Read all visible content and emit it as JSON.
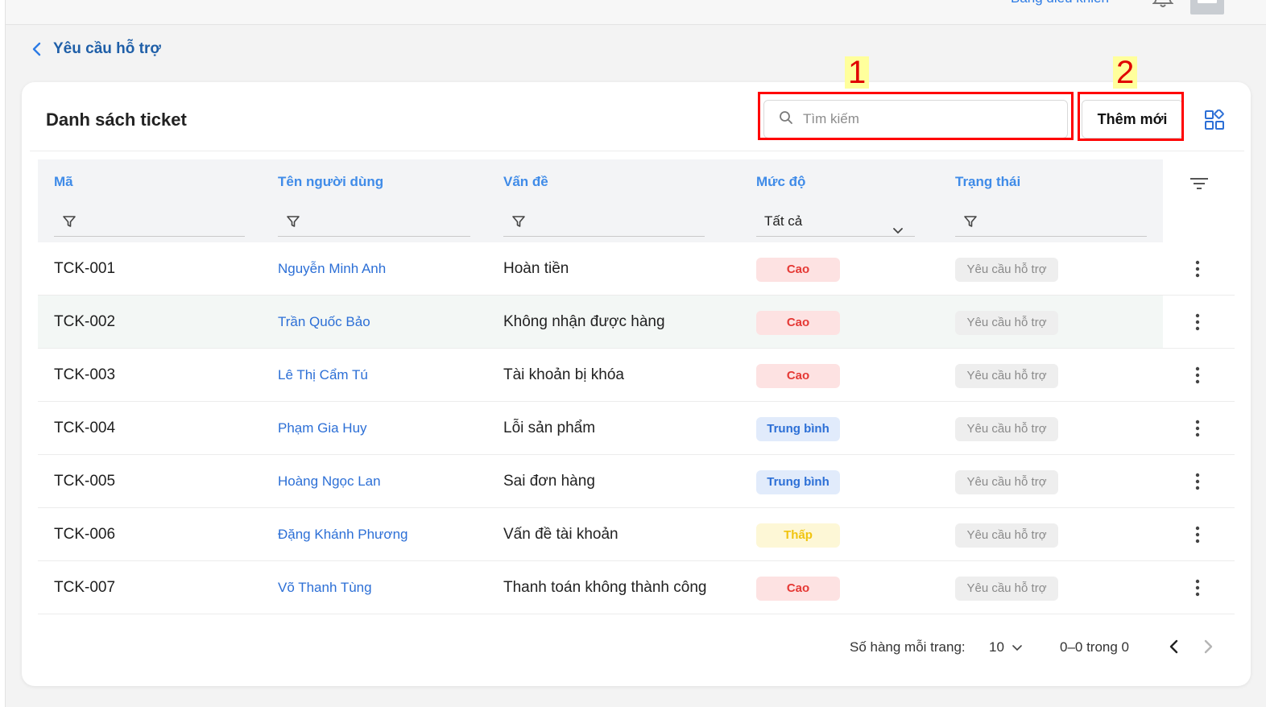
{
  "topbar": {
    "dashboard_link": "Bảng điều khiển"
  },
  "breadcrumb": {
    "label": "Yêu cầu hỗ trợ"
  },
  "card": {
    "title": "Danh sách ticket",
    "search_placeholder": "Tìm kiếm",
    "add_button": "Thêm mới",
    "annotations": [
      "1",
      "2"
    ]
  },
  "table": {
    "columns": {
      "code": "Mã",
      "user": "Tên người dùng",
      "issue": "Vấn đề",
      "level": "Mức độ",
      "status": "Trạng thái"
    },
    "level_filter_value": "Tất cả",
    "rows": [
      {
        "code": "TCK-001",
        "user": "Nguyễn Minh Anh",
        "issue": "Hoàn tiền",
        "level": "Cao",
        "status": "Yêu cầu hỗ trợ"
      },
      {
        "code": "TCK-002",
        "user": "Trần Quốc Bảo",
        "issue": "Không nhận được hàng",
        "level": "Cao",
        "status": "Yêu cầu hỗ trợ"
      },
      {
        "code": "TCK-003",
        "user": "Lê Thị Cẩm Tú",
        "issue": "Tài khoản bị khóa",
        "level": "Cao",
        "status": "Yêu cầu hỗ trợ"
      },
      {
        "code": "TCK-004",
        "user": "Phạm Gia Huy",
        "issue": "Lỗi sản phẩm",
        "level": "Trung bình",
        "status": "Yêu cầu hỗ trợ"
      },
      {
        "code": "TCK-005",
        "user": "Hoàng Ngọc Lan",
        "issue": "Sai đơn hàng",
        "level": "Trung bình",
        "status": "Yêu cầu hỗ trợ"
      },
      {
        "code": "TCK-006",
        "user": "Đặng Khánh Phương",
        "issue": "Vấn đề tài khoản",
        "level": "Thấp",
        "status": "Yêu cầu hỗ trợ"
      },
      {
        "code": "TCK-007",
        "user": "Võ Thanh Tùng",
        "issue": "Thanh toán không thành công",
        "level": "Cao",
        "status": "Yêu cầu hỗ trợ"
      }
    ]
  },
  "pagination": {
    "rows_per_page_label": "Số hàng mỗi trang:",
    "rows_per_page_value": "10",
    "range_text": "0–0 trong 0"
  },
  "colors": {
    "accent": "#3f8be8",
    "link": "#2c6fd6",
    "highlight": "#ff0000",
    "level_high": "#e53935",
    "level_mid": "#2c6fd6",
    "level_low": "#f1c40f"
  }
}
